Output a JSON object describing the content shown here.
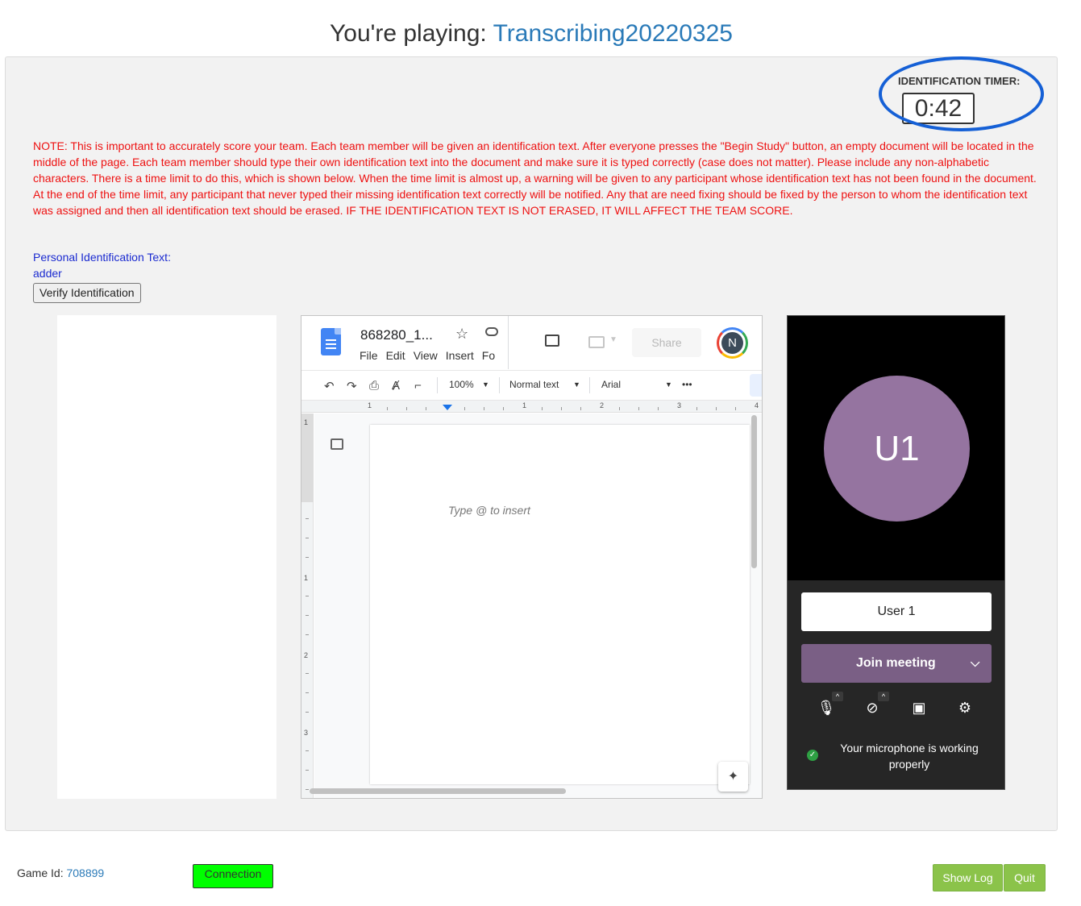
{
  "header": {
    "prefix": "You're playing: ",
    "game_name": "Transcribing20220325"
  },
  "timer": {
    "label": "IDENTIFICATION TIMER:",
    "value": "0:42"
  },
  "note": "NOTE: This is important to accurately score your team. Each team member will be given an identification text. After everyone presses the \"Begin Study\" button, an empty document will be located in the middle of the page. Each team member should type their own identification text into the document and make sure it is typed correctly (case does not matter). Please include any non-alphabetic characters. There is a time limit to do this, which is shown below. When the time limit is almost up, a warning will be given to any participant whose identification text has not been found in the document. At the end of the time limit, any participant that never typed their missing identification text correctly will be notified. Any that are need fixing should be fixed by the person to whom the identification text was assigned and then all identification text should be erased. IF THE IDENTIFICATION TEXT IS NOT ERASED, IT WILL AFFECT THE TEAM SCORE.",
  "identification": {
    "label": "Personal Identification Text:",
    "value": "adder",
    "verify_button": "Verify Identification"
  },
  "doc": {
    "title": "868280_1...",
    "menu": [
      "File",
      "Edit",
      "View",
      "Insert",
      "Fo"
    ],
    "share": "Share",
    "avatar_initial": "N",
    "zoom": "100%",
    "style": "Normal text",
    "font": "Arial",
    "more": "•••",
    "ruler_h": [
      "1",
      "1",
      "2",
      "3",
      "4"
    ],
    "ruler_v": [
      "1",
      "1",
      "2",
      "3"
    ],
    "placeholder": "Type @ to insert"
  },
  "meeting": {
    "avatar": "U1",
    "name": "User 1",
    "join": "Join meeting",
    "mic_status": "Your microphone is working properly"
  },
  "footer": {
    "game_id_label": "Game Id: ",
    "game_id": "708899",
    "connection": "Connection",
    "show_log": "Show Log",
    "quit": "Quit"
  },
  "colors": {
    "note": "#ee1111",
    "link": "#2a7ab8",
    "annotation_oval": "#1560d6",
    "connection": "#00ff00",
    "footer_button": "#8bc34a",
    "meet_join": "#7a5f85",
    "meet_avatar": "#9574a0"
  }
}
